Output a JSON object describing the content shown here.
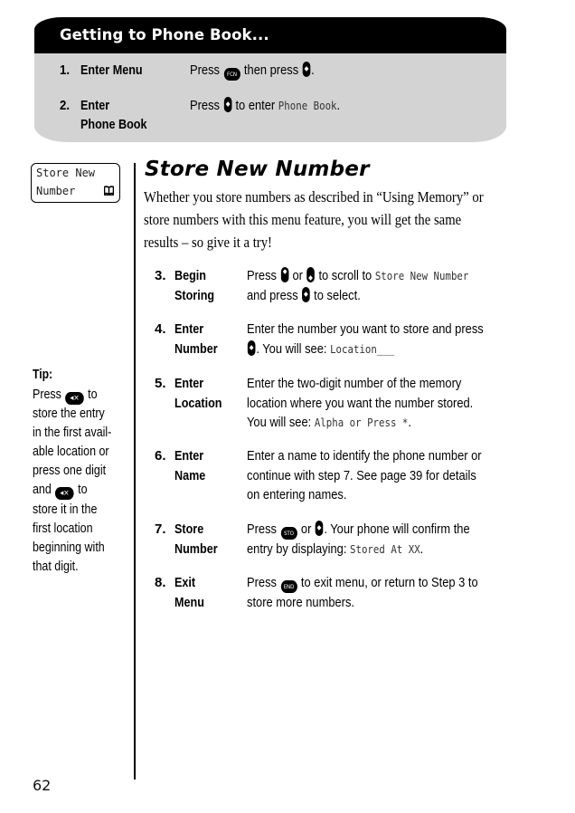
{
  "header": {
    "title": "Getting to Phone Book...",
    "steps": [
      {
        "number": "1.",
        "label_lines": [
          "Enter Menu"
        ],
        "desc": {
          "before": "Press",
          "key1": "FCN",
          "middle": "then press",
          "after": "."
        }
      },
      {
        "number": "2.",
        "label_lines": [
          "Enter",
          "Phone Book"
        ],
        "desc": {
          "before": "Press",
          "middle": "to enter",
          "display": "Phone Book",
          "after": "."
        }
      }
    ]
  },
  "lcd": {
    "line1": "Store New",
    "line2": "Number",
    "icon": "phone-book-icon"
  },
  "tip": {
    "title": "Tip:",
    "lines": [
      {
        "text": "Press",
        "key": "◂×",
        "after": "to"
      },
      {
        "text": "store the entry"
      },
      {
        "text": "in the first avail-"
      },
      {
        "text": "able location or"
      },
      {
        "text": "press one digit"
      },
      {
        "text": "and",
        "key": "◂×",
        "after": "to"
      },
      {
        "text": "store it in the"
      },
      {
        "text": "first location"
      },
      {
        "text": "beginning with"
      },
      {
        "text": "that digit."
      }
    ]
  },
  "main": {
    "title": "Store New Number",
    "intro_lines": [
      "Whether you store numbers as described in “Using Memory” or",
      "store numbers with this menu feature, you will get the same",
      "results – so give it a try!"
    ],
    "steps": [
      {
        "number": "3.",
        "label_lines": [
          "Begin",
          "Storing"
        ],
        "desc": {
          "l1_a": "Press",
          "l1_b": "or",
          "l1_c": "to scroll to",
          "l1_display": "Store New Number",
          "l2_a": "and press",
          "l2_b": "to select."
        }
      },
      {
        "number": "4.",
        "label_lines": [
          "Enter",
          "Number"
        ],
        "desc": {
          "l1": "Enter the number you want to store and press",
          "l2_a": ". You will see:",
          "l2_display": "Location___"
        }
      },
      {
        "number": "5.",
        "label_lines": [
          "Enter",
          "Location"
        ],
        "desc": {
          "l1": "Enter the two-digit number of the memory",
          "l2": "location where you want the number stored.",
          "l3_a": "You will see:",
          "l3_display": "Alpha or Press *",
          "l3_b": "."
        }
      },
      {
        "number": "6.",
        "label_lines": [
          "Enter",
          "Name"
        ],
        "desc": {
          "l1": "Enter a name to identify the phone number or",
          "l2": "continue with step 7. See page 39 for details",
          "l3": "on entering names."
        }
      },
      {
        "number": "7.",
        "label_lines": [
          "Store",
          "Number"
        ],
        "desc": {
          "l1_a": "Press",
          "l1_key": "STO",
          "l1_b": "or",
          "l1_c": ". Your phone will confirm the",
          "l2_a": "entry by displaying:",
          "l2_display": "Stored At XX",
          "l2_b": "."
        }
      },
      {
        "number": "8.",
        "label_lines": [
          "Exit",
          "Menu"
        ],
        "desc": {
          "l1_a": "Press",
          "l1_key": "END",
          "l1_b": "to exit menu, or return to Step 3 to",
          "l2": "store more numbers."
        }
      }
    ]
  },
  "page_number": "62"
}
